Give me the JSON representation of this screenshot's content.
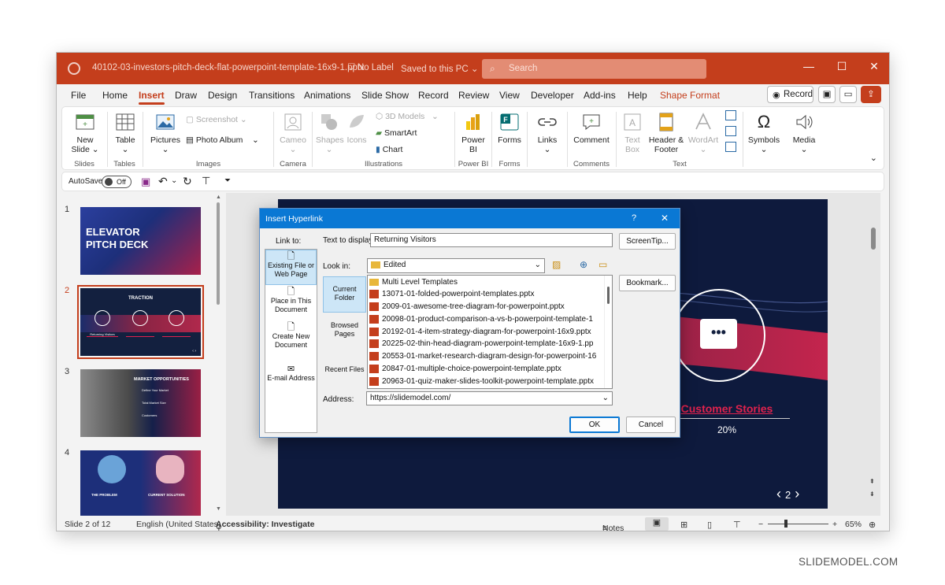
{
  "titlebar": {
    "filename": "40102-03-investors-pitch-deck-flat-powerpoint-template-16x9-1.pptx",
    "label": "No Label",
    "saved": "Saved to this PC",
    "search_placeholder": "Search",
    "accent": "#c43e1c"
  },
  "tabs": [
    "File",
    "Home",
    "Insert",
    "Draw",
    "Design",
    "Transitions",
    "Animations",
    "Slide Show",
    "Record",
    "Review",
    "View",
    "Developer",
    "Add-ins",
    "Help",
    "Shape Format"
  ],
  "active_tab": "Insert",
  "title_actions": {
    "record": "Record"
  },
  "ribbon": {
    "slides": {
      "new_slide": "New Slide",
      "group": "Slides"
    },
    "tables": {
      "table": "Table",
      "group": "Tables"
    },
    "images": {
      "pictures": "Pictures",
      "screenshot": "Screenshot",
      "photo_album": "Photo Album",
      "group": "Images"
    },
    "camera": {
      "cameo": "Cameo",
      "group": "Camera"
    },
    "illustrations": {
      "shapes": "Shapes",
      "icons": "Icons",
      "models3d": "3D Models",
      "smartart": "SmartArt",
      "chart": "Chart",
      "group": "Illustrations"
    },
    "powerbi": {
      "powerbi": "Power BI",
      "group": "Power BI"
    },
    "forms": {
      "forms": "Forms",
      "group": "Forms"
    },
    "links": {
      "links": "Links"
    },
    "comments": {
      "comment": "Comment",
      "group": "Comments"
    },
    "text": {
      "textbox": "Text Box",
      "header_footer": "Header & Footer",
      "wordart": "WordArt",
      "group": "Text"
    },
    "symbols": {
      "symbols": "Symbols"
    },
    "media": {
      "media": "Media"
    }
  },
  "qat": {
    "autosave": "AutoSave",
    "toggle": "Off"
  },
  "thumbnails": [
    {
      "num": "1",
      "title1": "ELEVATOR",
      "title2": "PITCH DECK"
    },
    {
      "num": "2",
      "heading": "TRACTION",
      "labels": [
        "Returning Visitors",
        "",
        ""
      ]
    },
    {
      "num": "3",
      "heading": "MARKET OPPORTUNITIES",
      "items": [
        "Define Your Market",
        "Total Market Size",
        "Customers"
      ]
    },
    {
      "num": "4",
      "labels": [
        "THE PROBLEM",
        "CURRENT SOLUTION"
      ]
    }
  ],
  "slide": {
    "link_text": "Customer Stories",
    "percent": "20%",
    "page": "2"
  },
  "dialog": {
    "title": "Insert Hyperlink",
    "help": "?",
    "link_to": "Link to:",
    "link_options": [
      "Existing File or Web Page",
      "Place in This Document",
      "Create New Document",
      "E-mail Address"
    ],
    "text_to_display_label": "Text to display:",
    "text_to_display": "Returning Visitors",
    "screentip": "ScreenTip...",
    "look_in_label": "Look in:",
    "look_in": "Edited",
    "side_options": [
      "Current Folder",
      "Browsed Pages",
      "Recent Files"
    ],
    "files": [
      "Multi Level Templates",
      "13071-01-folded-powerpoint-templates.pptx",
      "2009-01-awesome-tree-diagram-for-powerpoint.pptx",
      "20098-01-product-comparison-a-vs-b-powerpoint-template-1",
      "20192-01-4-item-strategy-diagram-for-powerpoint-16x9.pptx",
      "20225-02-thin-head-diagram-powerpoint-template-16x9-1.pp",
      "20553-01-market-research-diagram-design-for-powerpoint-16",
      "20847-01-multiple-choice-powerpoint-template.pptx",
      "20963-01-quiz-maker-slides-toolkit-powerpoint-template.pptx"
    ],
    "bookmark": "Bookmark...",
    "address_label": "Address:",
    "address": "https://slidemodel.com/",
    "ok": "OK",
    "cancel": "Cancel"
  },
  "status": {
    "slide": "Slide 2 of 12",
    "language": "English (United States)",
    "accessibility": "Accessibility: Investigate",
    "notes": "Notes",
    "zoom": "65%"
  },
  "watermark": "SLIDEMODEL.COM"
}
